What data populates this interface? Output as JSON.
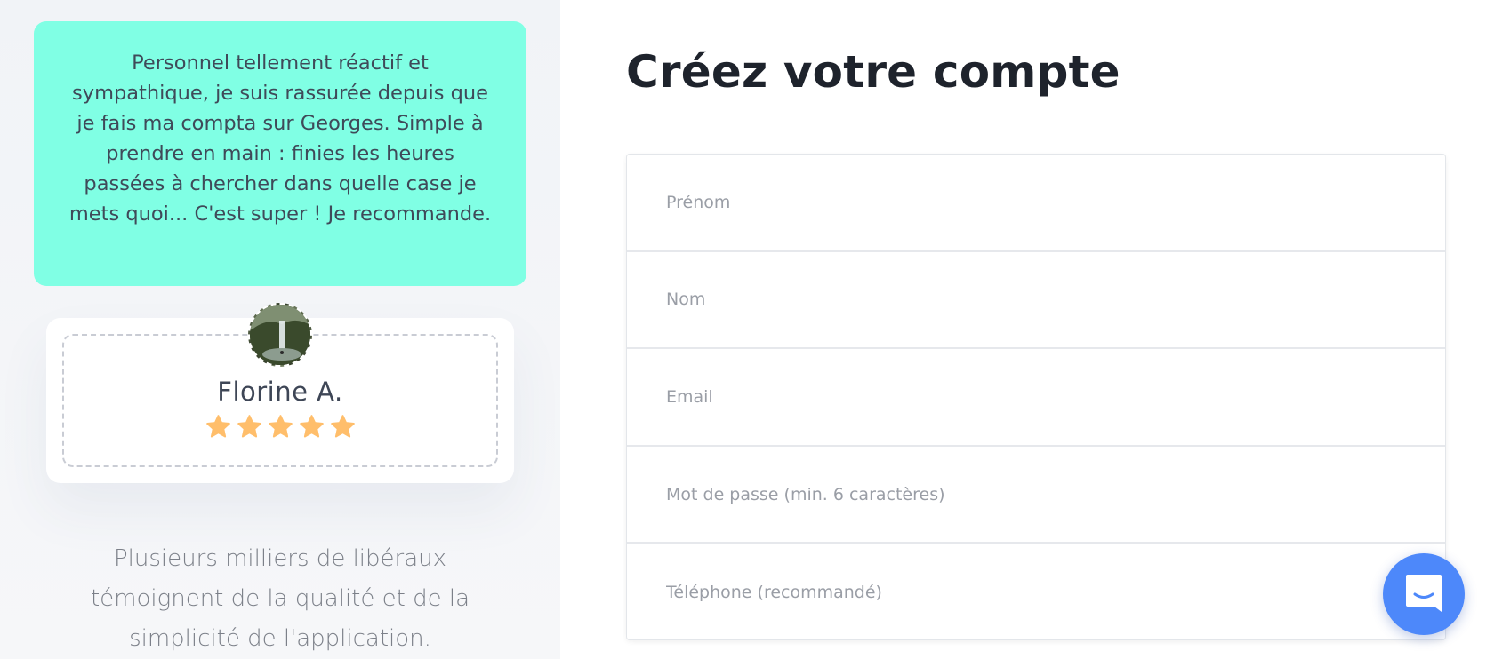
{
  "testimonial": {
    "quote": "Personnel tellement réactif et sympathique, je suis rassurée depuis que je fais ma compta sur Georges. Simple à prendre en main : finies les heures passées à chercher dans quelle case je mets quoi... C'est super ! Je recommande.",
    "quote_background": "#80ffe4",
    "author_name": "Florine A.",
    "rating": 5,
    "rating_max": 5,
    "star_color": "#ffbe6b"
  },
  "tagline": "Plusieurs milliers de libéraux témoignent de la qualité et de la simplicité de l'application.",
  "signup": {
    "title": "Créez votre compte",
    "fields": {
      "first_name": {
        "placeholder": "Prénom",
        "value": ""
      },
      "last_name": {
        "placeholder": "Nom",
        "value": ""
      },
      "email": {
        "placeholder": "Email",
        "value": ""
      },
      "password": {
        "placeholder": "Mot de passe (min. 6 caractères)",
        "value": ""
      },
      "phone": {
        "placeholder": "Téléphone (recommandé)",
        "value": ""
      }
    }
  },
  "chat_launcher": {
    "icon": "chat-bubble-icon",
    "color": "#4d88fa"
  }
}
